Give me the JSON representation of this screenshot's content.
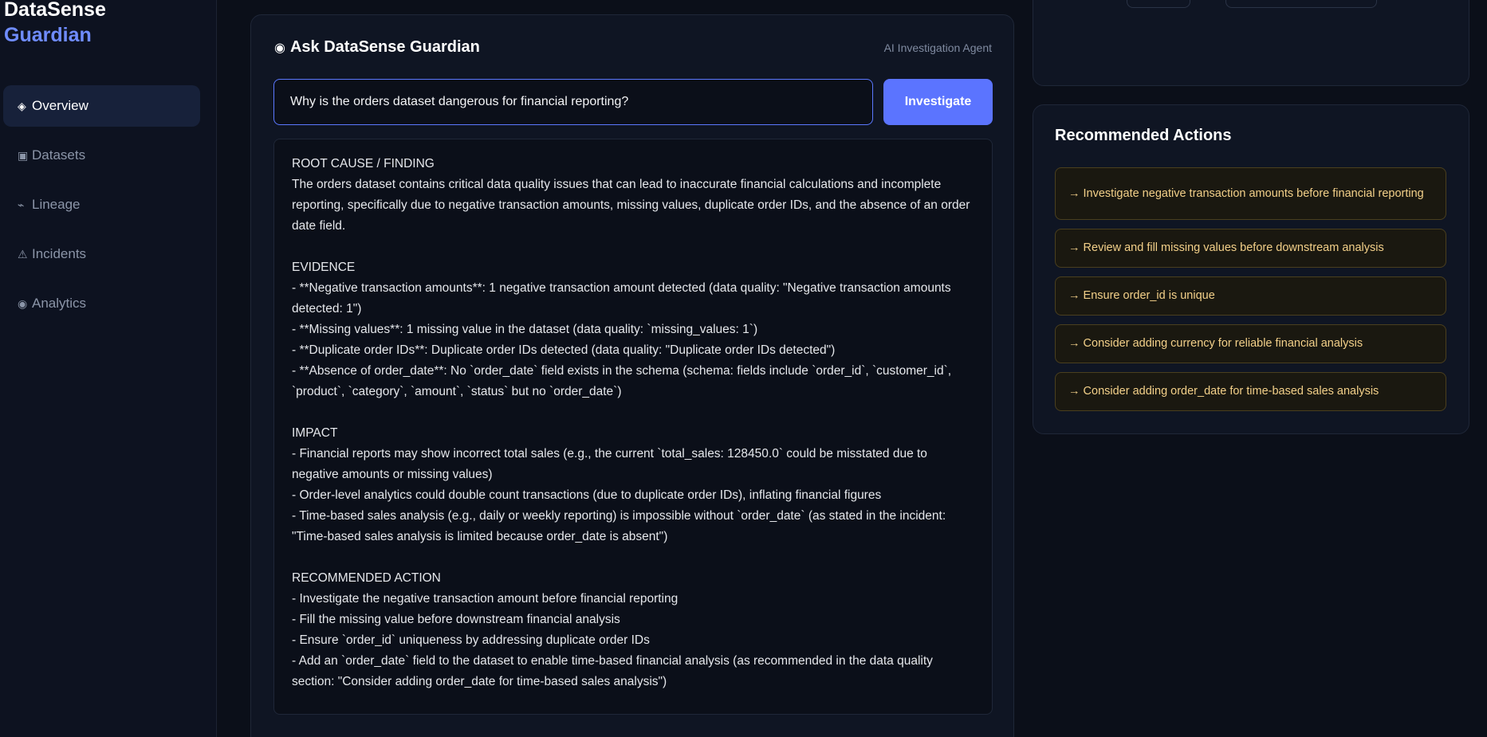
{
  "brand": {
    "line1": "DataSense",
    "line2": "Guardian"
  },
  "nav": {
    "items": [
      {
        "icon": "◈",
        "label": "Overview"
      },
      {
        "icon": "▣",
        "label": "Datasets"
      },
      {
        "icon": "⌁",
        "label": "Lineage"
      },
      {
        "icon": "⚠",
        "label": "Incidents"
      },
      {
        "icon": "◉",
        "label": "Analytics"
      }
    ]
  },
  "ask": {
    "title_icon": "◉",
    "title": "Ask DataSense Guardian",
    "subtitle": "AI Investigation Agent",
    "query_value": "Why is the orders dataset dangerous for financial reporting?",
    "button_label": "Investigate"
  },
  "result": {
    "root_cause": "ROOT CAUSE / FINDING\nThe orders dataset contains critical data quality issues that can lead to inaccurate financial calculations and incomplete reporting, specifically due to negative transaction amounts, missing values, duplicate order IDs, and the absence of an order date field.",
    "evidence": "EVIDENCE\n- **Negative transaction amounts**: 1 negative transaction amount detected (data quality: \"Negative transaction amounts detected: 1\")\n- **Missing values**: 1 missing value in the dataset (data quality: `missing_values: 1`)\n- **Duplicate order IDs**: Duplicate order IDs detected (data quality: \"Duplicate order IDs detected\")\n- **Absence of order_date**: No `order_date` field exists in the schema (schema: fields include `order_id`, `customer_id`, `product`, `category`, `amount`, `status` but no `order_date`)",
    "impact": "IMPACT\n- Financial reports may show incorrect total sales (e.g., the current `total_sales: 128450.0` could be misstated due to negative amounts or missing values)\n- Order-level analytics could double count transactions (due to duplicate order IDs), inflating financial figures\n- Time-based sales analysis (e.g., daily or weekly reporting) is impossible without `order_date` (as stated in the incident: \"Time-based sales analysis is limited because order_date is absent\")",
    "recommended": "RECOMMENDED ACTION\n- Investigate the negative transaction amount before financial reporting\n- Fill the missing value before downstream financial analysis\n- Ensure `order_id` uniqueness by addressing duplicate order IDs\n- Add an `order_date` field to the dataset to enable time-based financial analysis (as recommended in the data quality section: \"Consider adding order_date for time-based sales analysis\")"
  },
  "actions": {
    "title": "Recommended Actions",
    "items": [
      "→ Investigate negative transaction amounts before financial reporting",
      "→ Review and fill missing values before downstream analysis",
      "→ Ensure order_id is unique",
      "→ Consider adding currency for reliable financial analysis",
      "→ Consider adding order_date for time-based sales analysis"
    ]
  },
  "colors": {
    "accent": "#5b74ff",
    "brand_accent": "#6f8cff",
    "action_text": "#f3d089",
    "background": "#0b0f19"
  }
}
